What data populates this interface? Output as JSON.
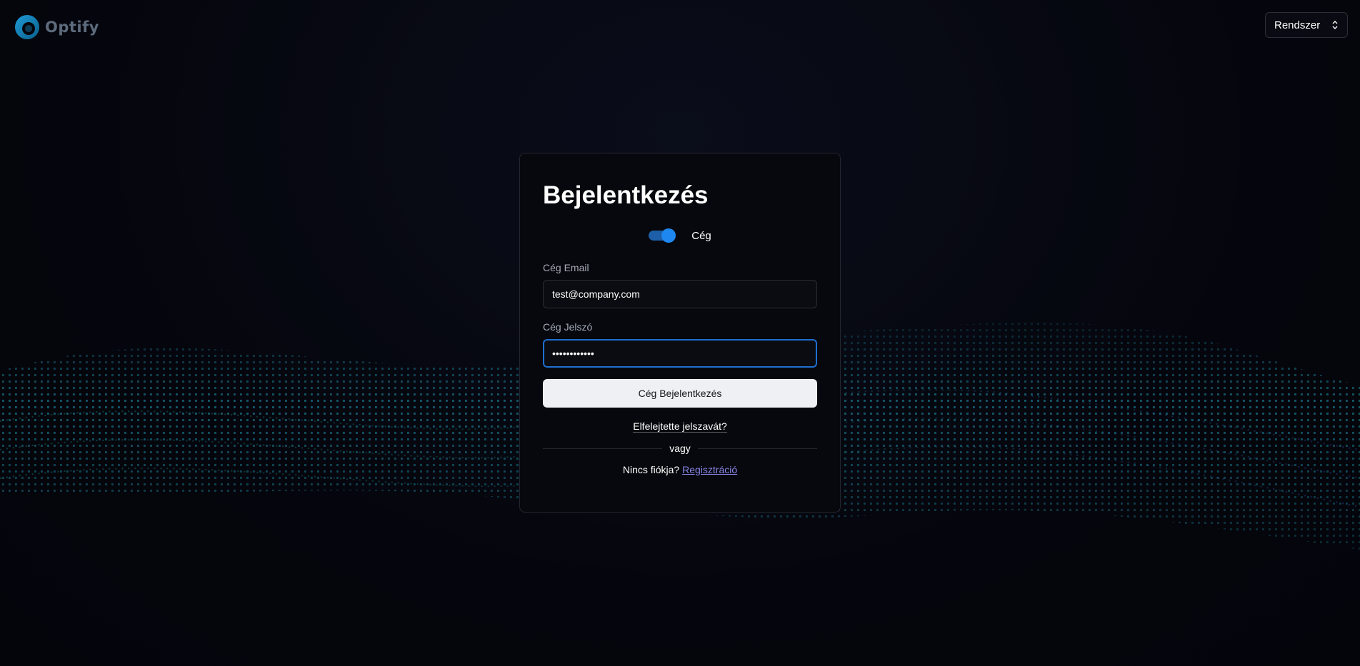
{
  "app": {
    "logo_text": "Optify",
    "logo_icon": "optify-logo-icon"
  },
  "theme_select": {
    "value": "Rendszer",
    "icon": "chevron-up-down-icon"
  },
  "login": {
    "title": "Bejelentkezés",
    "toggle": {
      "label": "Cég",
      "checked": true
    },
    "email": {
      "label": "Cég Email",
      "value": "test@company.com"
    },
    "password": {
      "label": "Cég Jelszó",
      "value": "••••••••••••"
    },
    "submit_label": "Cég Bejelentkezés",
    "forgot_label": "Elfelejtette jelszavát?",
    "divider_label": "vagy",
    "no_account_text": "Nincs fiókja?",
    "register_label": "Regisztráció"
  },
  "colors": {
    "background": "#05060d",
    "accent": "#1e88f0",
    "link": "#8b86e8",
    "wave_teal": "#1aa3a0",
    "wave_blue": "#3a5bd0"
  }
}
